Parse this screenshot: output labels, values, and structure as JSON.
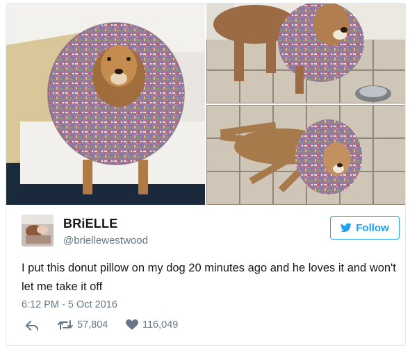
{
  "author": {
    "name": "BRiELLE",
    "handle": "@briellewestwood",
    "follow_label": "Follow"
  },
  "tweet": {
    "text": "I put this donut pillow on my dog 20 minutes ago and he loves it and won't let me take it off",
    "timestamp": "6:12 PM - 5 Oct 2016",
    "retweets": "57,804",
    "likes": "116,049"
  },
  "icons": {
    "reply": "reply-icon",
    "retweet": "retweet-icon",
    "like": "heart-icon",
    "follow": "twitter-bird-icon"
  },
  "colors": {
    "accent": "#1da1f2",
    "secondary_text": "#657786",
    "border": "#e1e8ed"
  }
}
